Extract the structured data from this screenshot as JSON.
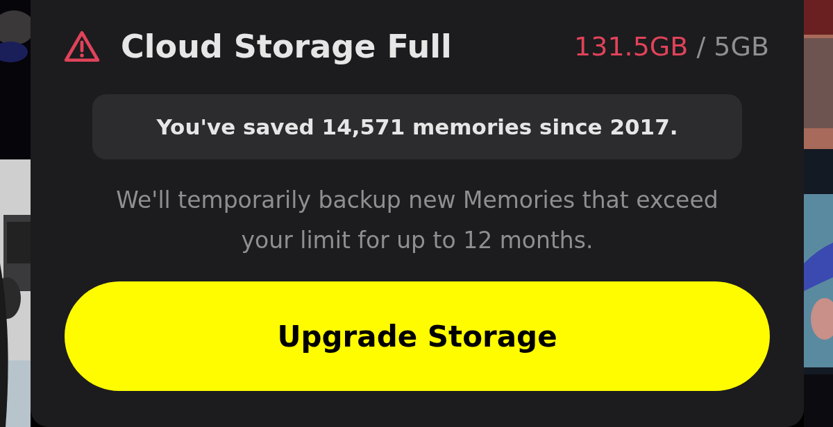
{
  "dialog": {
    "title": "Cloud Storage Full",
    "usage": {
      "used": "131.5GB",
      "separator": "/",
      "limit": "5GB"
    },
    "summary": "You've saved 14,571 memories since 2017.",
    "message": "We'll temporarily backup new Memories that exceed your limit for up to 12 months.",
    "button": "Upgrade Storage"
  }
}
